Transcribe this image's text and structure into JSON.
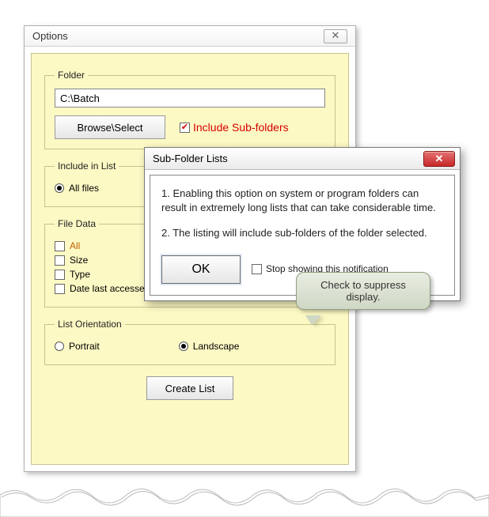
{
  "window": {
    "title": "Options",
    "close_glyph": "✕"
  },
  "folder": {
    "legend": "Folder",
    "path": "C:\\Batch",
    "browse_label": "Browse\\Select",
    "include_sub_label": "Include Sub-folders",
    "include_sub_checked": true
  },
  "include_in_list": {
    "legend": "Include in List",
    "all_files_label": "All files",
    "all_files_checked": true
  },
  "file_data": {
    "legend": "File Data",
    "items": [
      {
        "label": "All",
        "checked": false,
        "accent": true
      },
      {
        "label": "Size",
        "checked": false,
        "accent": false
      },
      {
        "label": "Type",
        "checked": false,
        "accent": false
      },
      {
        "label": "Date last accessed",
        "checked": false,
        "accent": false
      }
    ]
  },
  "orientation": {
    "legend": "List Orientation",
    "portrait_label": "Portrait",
    "landscape_label": "Landscape",
    "selected": "landscape"
  },
  "create_label": "Create List",
  "dialog": {
    "title": "Sub-Folder Lists",
    "close_glyph": "✕",
    "para1": "1. Enabling this option on system or program folders can result in extremely long lists that can take considerable time.",
    "para2": "2. The listing will include sub-folders of the folder selected.",
    "ok_label": "OK",
    "stop_label": "Stop showing this notification",
    "stop_checked": false
  },
  "callout": {
    "text": "Check to suppress display."
  }
}
